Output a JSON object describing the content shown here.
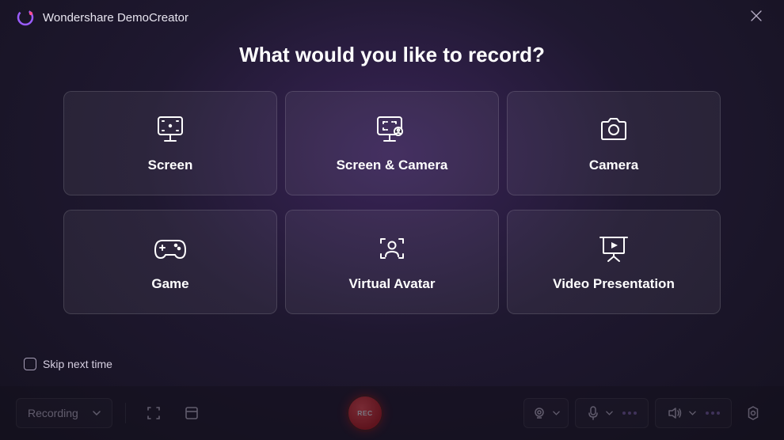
{
  "brand": "Wondershare DemoCreator",
  "heading": "What would you like to record?",
  "cards": [
    {
      "label": "Screen"
    },
    {
      "label": "Screen & Camera"
    },
    {
      "label": "Camera"
    },
    {
      "label": "Game"
    },
    {
      "label": "Virtual Avatar"
    },
    {
      "label": "Video Presentation"
    }
  ],
  "skip": "Skip next time",
  "toolbar": {
    "mode": "Recording",
    "rec": "REC"
  }
}
